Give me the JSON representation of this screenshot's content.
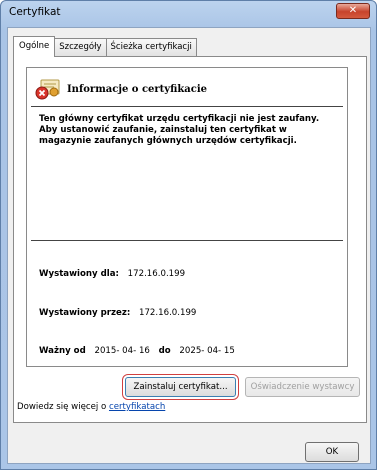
{
  "window": {
    "title": "Certyfikat",
    "close_glyph": "✕"
  },
  "tabs": [
    {
      "label": "Ogólne"
    },
    {
      "label": "Szczegóły"
    },
    {
      "label": "Ścieżka certyfikacji"
    }
  ],
  "info": {
    "icon": "certificate-error-icon",
    "title": "Informacje o certyfikacie",
    "warning": "Ten główny certyfikat urzędu certyfikacji nie jest zaufany. Aby ustanowić zaufanie, zainstaluj ten certyfikat w magazynie zaufanych głównych urzędów certyfikacji."
  },
  "fields": {
    "issued_to_label": "Wystawiony dla:",
    "issued_to_value": "172.16.0.199",
    "issued_by_label": "Wystawiony przez:",
    "issued_by_value": "172.16.0.199",
    "valid_label": "Ważny od",
    "valid_from": "2015- 04- 16",
    "valid_to_label": "do",
    "valid_to": "2025- 04- 15"
  },
  "buttons": {
    "install": "Zainstaluj certyfikat...",
    "issuer_statement": "Oświadczenie wystawcy",
    "ok": "OK"
  },
  "more": {
    "prefix": "Dowiedz się więcej o ",
    "link": "certyfikatach"
  }
}
